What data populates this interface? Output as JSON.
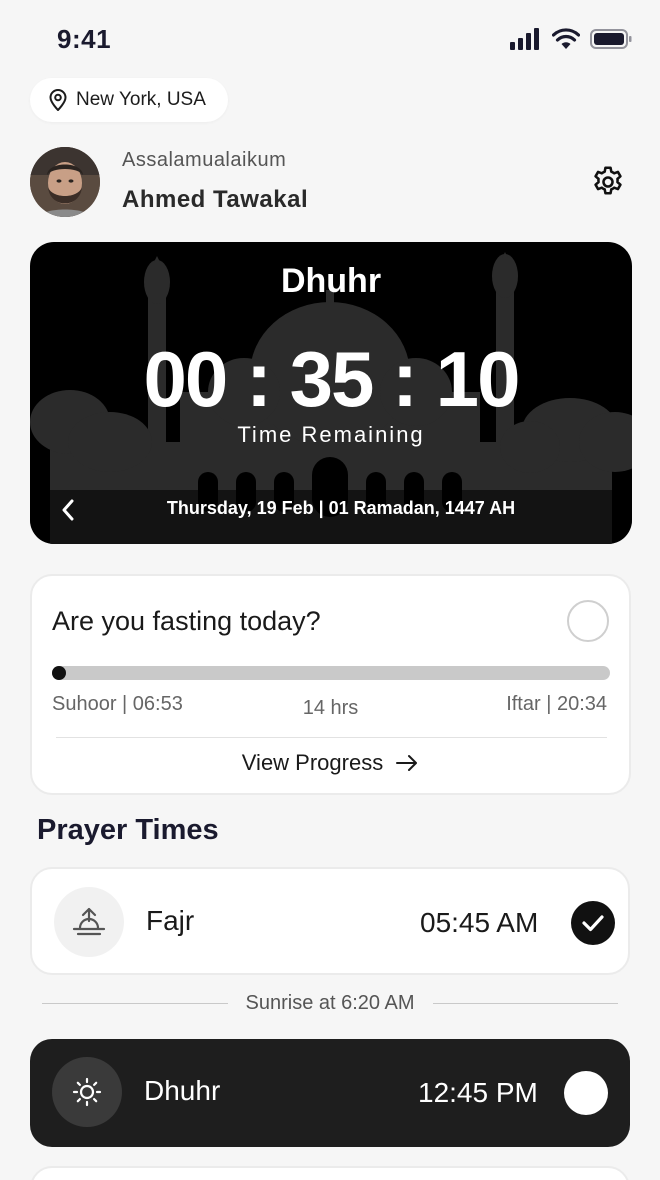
{
  "status_bar": {
    "time": "9:41"
  },
  "location": {
    "label": "New York, USA"
  },
  "user": {
    "greeting": "Assalamualaikum",
    "name": "Ahmed Tawakal"
  },
  "countdown": {
    "prayer": "Dhuhr",
    "timer": "00 : 35 : 10",
    "subtitle": "Time Remaining",
    "date": "Thursday, 19 Feb | 01 Ramadan, 1447 AH"
  },
  "fasting": {
    "question": "Are you fasting today?",
    "suhoor": "Suhoor | 06:53",
    "duration": "14 hrs",
    "iftar": "Iftar | 20:34",
    "progress_fraction": 0,
    "view_progress_label": "View Progress"
  },
  "prayer_section": {
    "title": "Prayer Times",
    "sunrise_note": "Sunrise at 6:20 AM",
    "prayers": [
      {
        "name": "Fajr",
        "time": "05:45 AM",
        "checked": true,
        "icon": "sunrise-icon"
      },
      {
        "name": "Dhuhr",
        "time": "12:45 PM",
        "checked": false,
        "active": true,
        "icon": "sun-icon"
      }
    ]
  },
  "colors": {
    "background": "#f6f6f6",
    "card": "#ffffff",
    "dark_card": "#1e1e1e",
    "accent": "#111111",
    "track": "#c9c9c9"
  }
}
